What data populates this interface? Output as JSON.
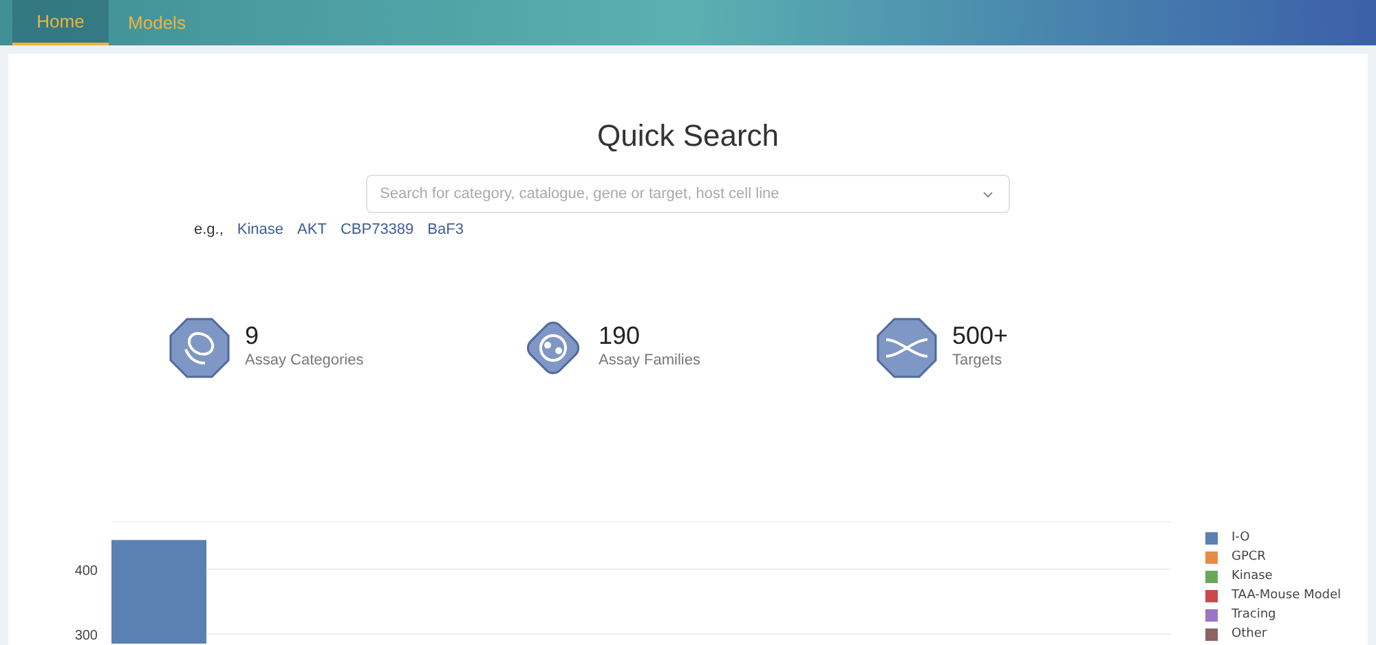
{
  "nav": {
    "tabs": [
      {
        "label": "Home",
        "selected": true
      },
      {
        "label": "Models",
        "selected": false
      }
    ]
  },
  "search": {
    "title": "Quick Search",
    "placeholder": "Search for category, catalogue, gene or target, host cell line",
    "examples_label": "e.g.,",
    "examples": [
      "Kinase",
      "AKT",
      "CBP73389",
      "BaF3"
    ]
  },
  "stats": [
    {
      "kind": "categories",
      "value": "9",
      "label": "Assay Categories"
    },
    {
      "kind": "families",
      "value": "190",
      "label": "Assay Families"
    },
    {
      "kind": "targets",
      "value": "500+",
      "label": "Targets"
    }
  ],
  "chart": {
    "chart_data": {
      "type": "bar",
      "ylim": [
        285,
        474
      ],
      "yticks": [
        300,
        400
      ],
      "series": [
        {
          "name": "I-O",
          "color": "#5b80b2",
          "values": [
            445
          ]
        },
        {
          "name": "GPCR",
          "color": "#e68c47",
          "values": [
            null
          ]
        },
        {
          "name": "Kinase",
          "color": "#67a95b",
          "values": [
            null
          ]
        },
        {
          "name": "TAA-Mouse Model",
          "color": "#c94a4a",
          "values": [
            null
          ]
        },
        {
          "name": "Tracing",
          "color": "#9a76c2",
          "values": [
            null
          ]
        },
        {
          "name": "Other",
          "color": "#8c6460",
          "values": [
            null
          ]
        }
      ]
    }
  }
}
